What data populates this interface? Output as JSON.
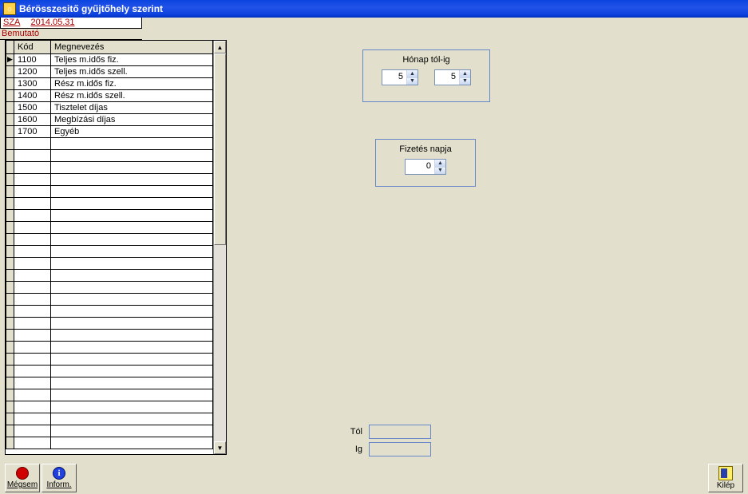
{
  "window": {
    "title": "Bérösszesitő gyűjtőhely szerint"
  },
  "header": {
    "code": "SZA",
    "date": "2014.05.31",
    "demo": "Bemutató"
  },
  "table": {
    "columns": {
      "kod": "Kód",
      "megnevezes": "Megnevezés"
    },
    "rows": [
      {
        "kod": "1100",
        "name": "Teljes m.idős fiz."
      },
      {
        "kod": "1200",
        "name": "Teljes m.idős szell."
      },
      {
        "kod": "1300",
        "name": "Rész m.idős fiz."
      },
      {
        "kod": "1400",
        "name": "Rész m.idős szell."
      },
      {
        "kod": "1500",
        "name": "Tisztelet díjas"
      },
      {
        "kod": "1600",
        "name": "Megbízási díjas"
      },
      {
        "kod": "1700",
        "name": "Egyéb"
      }
    ],
    "empty_row_count": 26
  },
  "month_box": {
    "legend": "Hónap tól-ig",
    "from": "5",
    "to": "5"
  },
  "payday_box": {
    "legend": "Fizetés napja",
    "value": "0"
  },
  "range": {
    "from_label": "Tól",
    "to_label": "Ig",
    "from_value": "",
    "to_value": ""
  },
  "buttons": {
    "cancel": "Mégsem",
    "info": "Inform.",
    "exit": "Kilép"
  }
}
